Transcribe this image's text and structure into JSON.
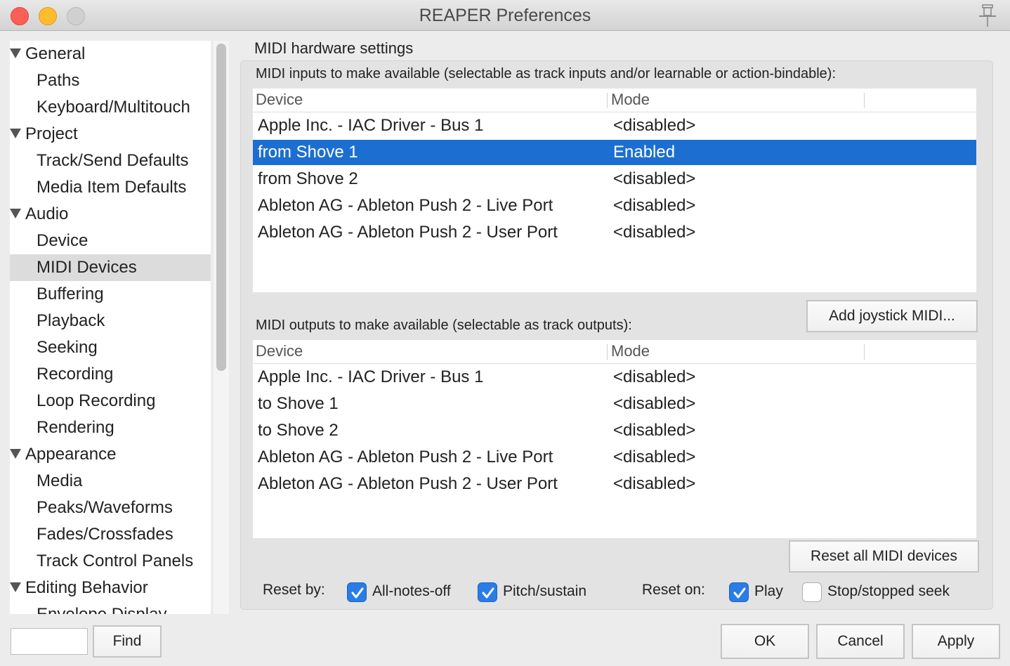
{
  "window": {
    "title": "REAPER Preferences"
  },
  "sidebar": {
    "items": [
      {
        "label": "General",
        "expandable": true,
        "selected": false
      },
      {
        "label": "Paths",
        "expandable": false,
        "selected": false
      },
      {
        "label": "Keyboard/Multitouch",
        "expandable": false,
        "selected": false
      },
      {
        "label": "Project",
        "expandable": true,
        "selected": false
      },
      {
        "label": "Track/Send Defaults",
        "expandable": false,
        "selected": false
      },
      {
        "label": "Media Item Defaults",
        "expandable": false,
        "selected": false
      },
      {
        "label": "Audio",
        "expandable": true,
        "selected": false
      },
      {
        "label": "Device",
        "expandable": false,
        "selected": false
      },
      {
        "label": "MIDI Devices",
        "expandable": false,
        "selected": true
      },
      {
        "label": "Buffering",
        "expandable": false,
        "selected": false
      },
      {
        "label": "Playback",
        "expandable": false,
        "selected": false
      },
      {
        "label": "Seeking",
        "expandable": false,
        "selected": false
      },
      {
        "label": "Recording",
        "expandable": false,
        "selected": false
      },
      {
        "label": "Loop Recording",
        "expandable": false,
        "selected": false
      },
      {
        "label": "Rendering",
        "expandable": false,
        "selected": false
      },
      {
        "label": "Appearance",
        "expandable": true,
        "selected": false
      },
      {
        "label": "Media",
        "expandable": false,
        "selected": false
      },
      {
        "label": "Peaks/Waveforms",
        "expandable": false,
        "selected": false
      },
      {
        "label": "Fades/Crossfades",
        "expandable": false,
        "selected": false
      },
      {
        "label": "Track Control Panels",
        "expandable": false,
        "selected": false
      },
      {
        "label": "Editing Behavior",
        "expandable": true,
        "selected": false
      },
      {
        "label": "Envelope Display",
        "expandable": false,
        "selected": false
      }
    ],
    "search": {
      "value": "",
      "find_label": "Find"
    }
  },
  "main": {
    "section_title": "MIDI hardware settings",
    "inputs": {
      "label": "MIDI inputs to make available (selectable as track inputs and/or learnable or action-bindable):",
      "columns": {
        "device": "Device",
        "mode": "Mode"
      },
      "rows": [
        {
          "device": "Apple Inc. - IAC Driver - Bus 1",
          "mode": "<disabled>",
          "selected": false
        },
        {
          "device": "from Shove 1",
          "mode": "Enabled",
          "selected": true
        },
        {
          "device": "from Shove 2",
          "mode": "<disabled>",
          "selected": false
        },
        {
          "device": "Ableton AG - Ableton Push 2 - Live Port",
          "mode": "<disabled>",
          "selected": false
        },
        {
          "device": "Ableton AG - Ableton Push 2 - User Port",
          "mode": "<disabled>",
          "selected": false
        }
      ]
    },
    "add_joystick_label": "Add joystick MIDI...",
    "outputs": {
      "label": "MIDI outputs to make available (selectable as track outputs):",
      "columns": {
        "device": "Device",
        "mode": "Mode"
      },
      "rows": [
        {
          "device": "Apple Inc. - IAC Driver - Bus 1",
          "mode": "<disabled>"
        },
        {
          "device": "to Shove 1",
          "mode": "<disabled>"
        },
        {
          "device": "to Shove 2",
          "mode": "<disabled>"
        },
        {
          "device": "Ableton AG - Ableton Push 2 - Live Port",
          "mode": "<disabled>"
        },
        {
          "device": "Ableton AG - Ableton Push 2 - User Port",
          "mode": "<disabled>"
        }
      ]
    },
    "reset_all_label": "Reset all MIDI devices",
    "reset_by": {
      "label": "Reset by:",
      "options": [
        {
          "label": "All-notes-off",
          "checked": true
        },
        {
          "label": "Pitch/sustain",
          "checked": true
        }
      ]
    },
    "reset_on": {
      "label": "Reset on:",
      "options": [
        {
          "label": "Play",
          "checked": true
        },
        {
          "label": "Stop/stopped seek",
          "checked": false
        }
      ]
    }
  },
  "footer": {
    "ok_label": "OK",
    "cancel_label": "Cancel",
    "apply_label": "Apply"
  },
  "colors": {
    "selection": "#1c6fd1",
    "checkbox_on": "#2a7ce6",
    "sidebar_selected": "#dcdcdc"
  }
}
